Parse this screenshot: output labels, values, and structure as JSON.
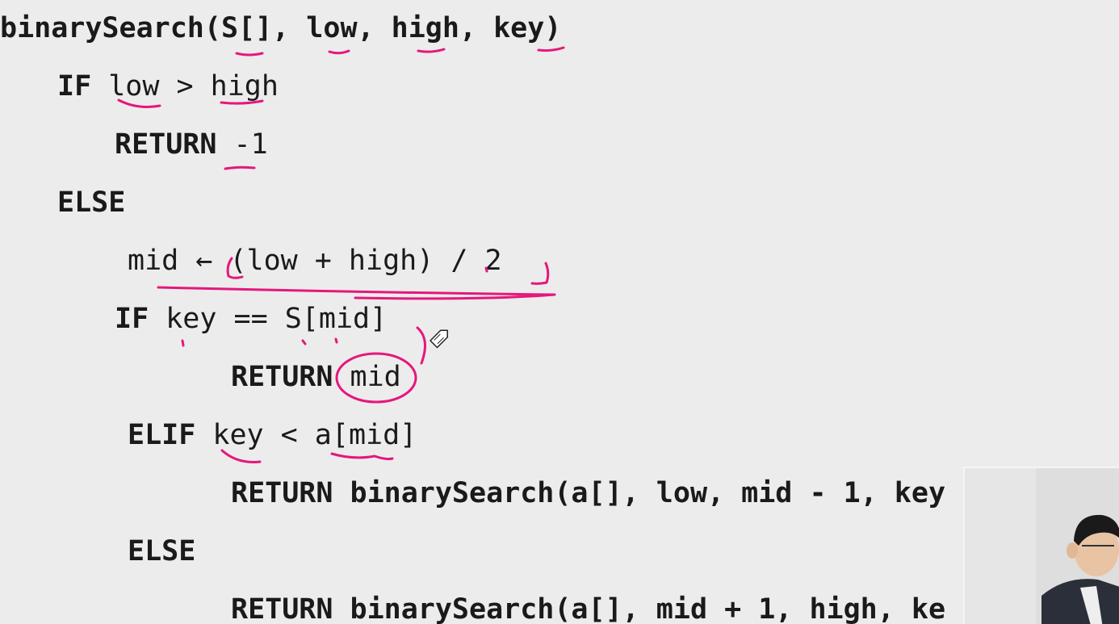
{
  "code": {
    "signature": {
      "name": "binarySearch",
      "params": "(S[], low, high, key)"
    },
    "line_if_low_high": {
      "kw": "IF",
      "cond": " low > high"
    },
    "line_return_neg": {
      "kw": "RETURN",
      "val": " -1"
    },
    "line_else": {
      "kw": "ELSE"
    },
    "line_mid": {
      "text": "mid ← (low + high) / 2"
    },
    "line_if_key": {
      "kw": "IF",
      "cond": " key == S[mid]"
    },
    "line_return_mid": {
      "kw": "RETURN",
      "val": " mid"
    },
    "line_elif": {
      "kw": "ELIF",
      "cond": " key < a[mid]"
    },
    "line_return_left": {
      "text": "RETURN binarySearch(a[], low, mid - 1, key"
    },
    "line_else2": {
      "kw": "ELSE"
    },
    "line_return_right": {
      "text": "RETURN binarySearch(a[], mid + 1, high, ke"
    }
  },
  "annotation": {
    "color": "#e5177b",
    "tool_icon": "pen-cursor-icon"
  },
  "webcam": {
    "icon": "presenter-video-icon"
  }
}
